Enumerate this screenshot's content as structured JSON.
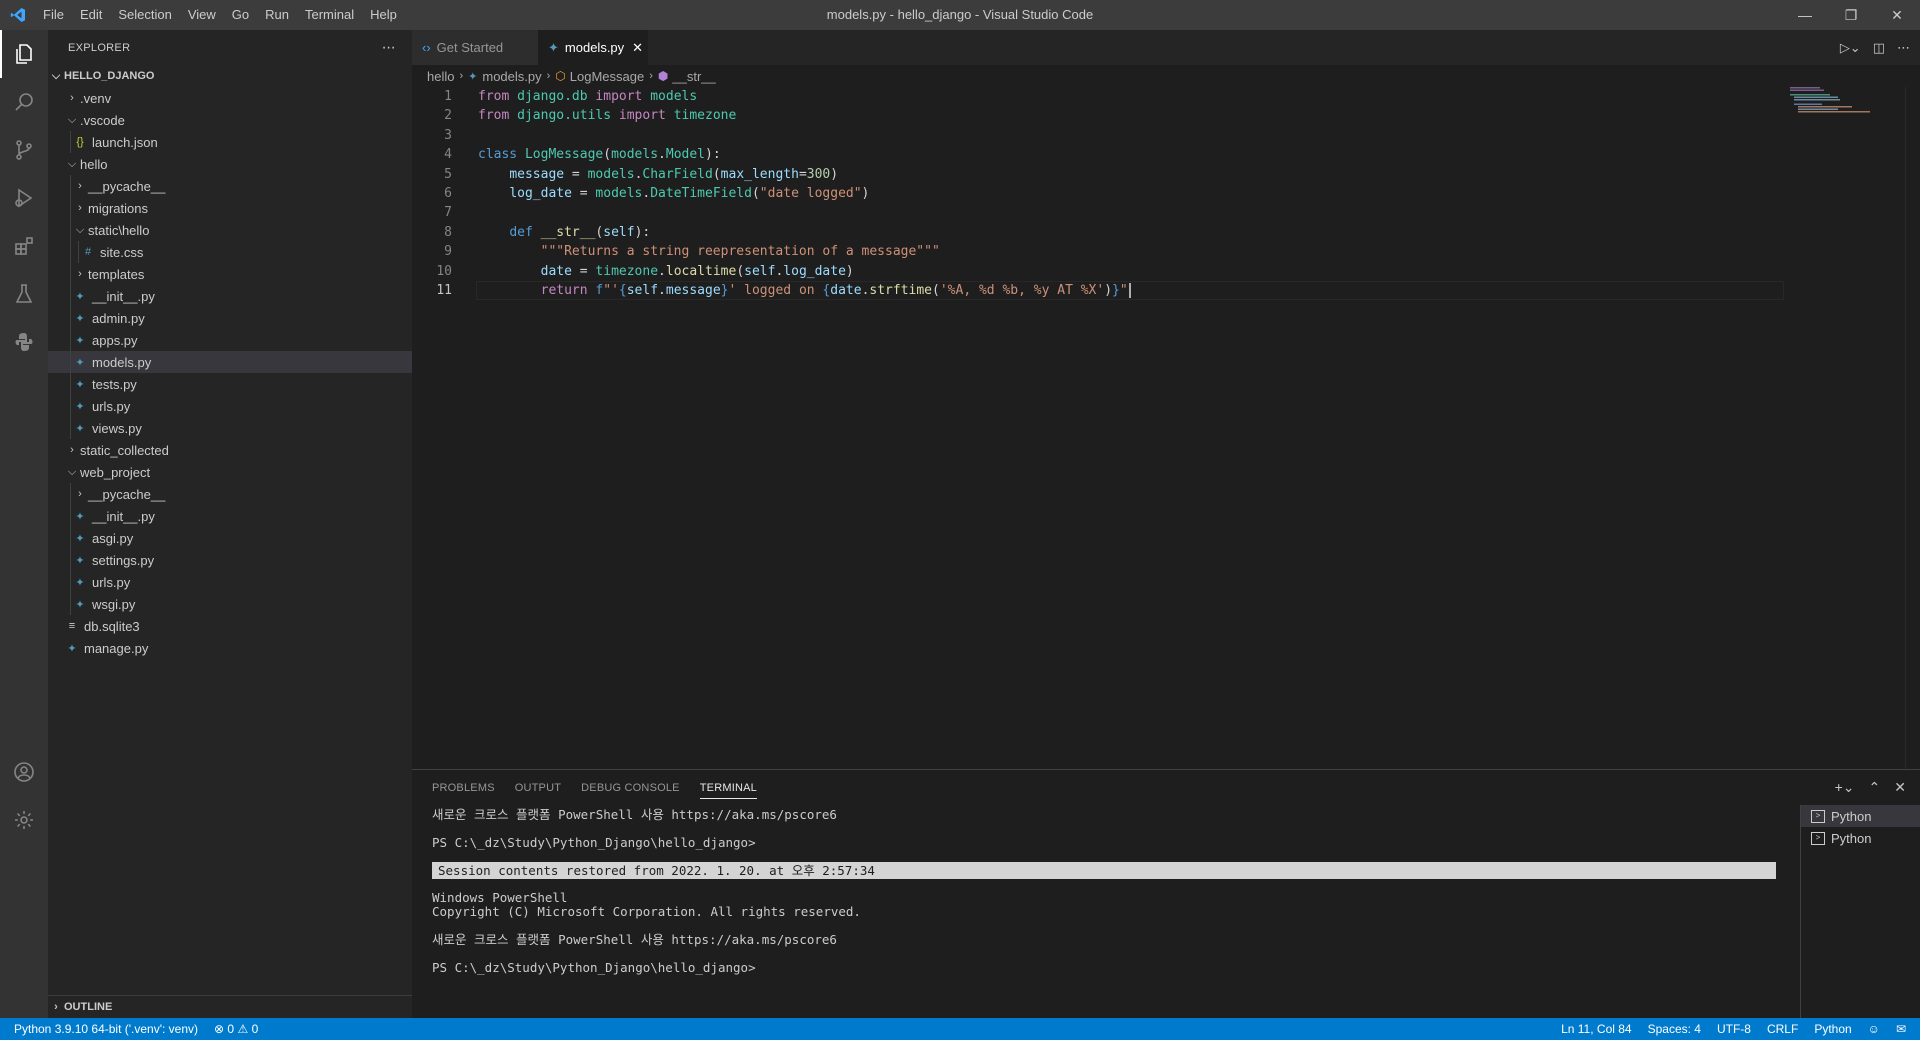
{
  "window": {
    "title": "models.py - hello_django - Visual Studio Code",
    "menu": [
      "File",
      "Edit",
      "Selection",
      "View",
      "Go",
      "Run",
      "Terminal",
      "Help"
    ]
  },
  "activity_bar": [
    "files-icon",
    "search-icon",
    "source-control-icon",
    "run-debug-icon",
    "extensions-icon",
    "testing-icon",
    "python-icon",
    "account-icon",
    "settings-gear-icon"
  ],
  "sidebar": {
    "title": "EXPLORER",
    "root": "HELLO_DJANGO",
    "tree": [
      {
        "label": ".venv",
        "type": "folder",
        "expanded": false,
        "depth": 1
      },
      {
        "label": ".vscode",
        "type": "folder",
        "expanded": true,
        "depth": 1
      },
      {
        "label": "launch.json",
        "type": "json",
        "depth": 2
      },
      {
        "label": "hello",
        "type": "folder",
        "expanded": true,
        "depth": 1
      },
      {
        "label": "__pycache__",
        "type": "folder",
        "expanded": false,
        "depth": 2
      },
      {
        "label": "migrations",
        "type": "folder",
        "expanded": false,
        "depth": 2
      },
      {
        "label": "static\\hello",
        "type": "folder",
        "expanded": true,
        "depth": 2
      },
      {
        "label": "site.css",
        "type": "css",
        "depth": 3
      },
      {
        "label": "templates",
        "type": "folder",
        "expanded": false,
        "depth": 2
      },
      {
        "label": "__init__.py",
        "type": "py",
        "depth": 2
      },
      {
        "label": "admin.py",
        "type": "py",
        "depth": 2
      },
      {
        "label": "apps.py",
        "type": "py",
        "depth": 2
      },
      {
        "label": "models.py",
        "type": "py",
        "depth": 2,
        "selected": true
      },
      {
        "label": "tests.py",
        "type": "py",
        "depth": 2
      },
      {
        "label": "urls.py",
        "type": "py",
        "depth": 2
      },
      {
        "label": "views.py",
        "type": "py",
        "depth": 2
      },
      {
        "label": "static_collected",
        "type": "folder",
        "expanded": false,
        "depth": 1
      },
      {
        "label": "web_project",
        "type": "folder",
        "expanded": true,
        "depth": 1
      },
      {
        "label": "__pycache__",
        "type": "folder",
        "expanded": false,
        "depth": 2
      },
      {
        "label": "__init__.py",
        "type": "py",
        "depth": 2
      },
      {
        "label": "asgi.py",
        "type": "py",
        "depth": 2
      },
      {
        "label": "settings.py",
        "type": "py",
        "depth": 2
      },
      {
        "label": "urls.py",
        "type": "py",
        "depth": 2
      },
      {
        "label": "wsgi.py",
        "type": "py",
        "depth": 2
      },
      {
        "label": "db.sqlite3",
        "type": "db",
        "depth": 1
      },
      {
        "label": "manage.py",
        "type": "py",
        "depth": 1
      }
    ],
    "outline_label": "OUTLINE"
  },
  "tabs": [
    {
      "label": "Get Started",
      "active": false
    },
    {
      "label": "models.py",
      "active": true
    }
  ],
  "breadcrumb": [
    "hello",
    "models.py",
    "LogMessage",
    "__str__"
  ],
  "editor": {
    "current_line": 11,
    "lines": [
      [
        [
          "kw",
          "from"
        ],
        [
          "t",
          " "
        ],
        [
          "mod",
          "django.db"
        ],
        [
          "t",
          " "
        ],
        [
          "kw",
          "import"
        ],
        [
          "t",
          " "
        ],
        [
          "mod",
          "models"
        ]
      ],
      [
        [
          "kw",
          "from"
        ],
        [
          "t",
          " "
        ],
        [
          "mod",
          "django.utils"
        ],
        [
          "t",
          " "
        ],
        [
          "kw",
          "import"
        ],
        [
          "t",
          " "
        ],
        [
          "mod",
          "timezone"
        ]
      ],
      [],
      [
        [
          "kwb",
          "class"
        ],
        [
          "t",
          " "
        ],
        [
          "mod",
          "LogMessage"
        ],
        [
          "t",
          "("
        ],
        [
          "mod",
          "models"
        ],
        [
          "t",
          "."
        ],
        [
          "mod",
          "Model"
        ],
        [
          "t",
          "):"
        ]
      ],
      [
        [
          "t",
          "    "
        ],
        [
          "var",
          "message"
        ],
        [
          "t",
          " = "
        ],
        [
          "mod",
          "models"
        ],
        [
          "t",
          "."
        ],
        [
          "mod",
          "CharField"
        ],
        [
          "t",
          "("
        ],
        [
          "var",
          "max_length"
        ],
        [
          "t",
          "="
        ],
        [
          "num",
          "300"
        ],
        [
          "t",
          ")"
        ]
      ],
      [
        [
          "t",
          "    "
        ],
        [
          "var",
          "log_date"
        ],
        [
          "t",
          " = "
        ],
        [
          "mod",
          "models"
        ],
        [
          "t",
          "."
        ],
        [
          "mod",
          "DateTimeField"
        ],
        [
          "t",
          "("
        ],
        [
          "str",
          "\"date logged\""
        ],
        [
          "t",
          ")"
        ]
      ],
      [],
      [
        [
          "t",
          "    "
        ],
        [
          "kwb",
          "def"
        ],
        [
          "t",
          " "
        ],
        [
          "fn",
          "__str__"
        ],
        [
          "t",
          "("
        ],
        [
          "var",
          "self"
        ],
        [
          "t",
          "):"
        ]
      ],
      [
        [
          "t",
          "        "
        ],
        [
          "str",
          "\"\"\"Returns a string reepresentation of a message\"\"\""
        ]
      ],
      [
        [
          "t",
          "        "
        ],
        [
          "var",
          "date"
        ],
        [
          "t",
          " = "
        ],
        [
          "mod",
          "timezone"
        ],
        [
          "t",
          "."
        ],
        [
          "fn",
          "localtime"
        ],
        [
          "t",
          "("
        ],
        [
          "var",
          "self"
        ],
        [
          "t",
          "."
        ],
        [
          "var",
          "log_date"
        ],
        [
          "t",
          ")"
        ]
      ],
      [
        [
          "t",
          "        "
        ],
        [
          "kw",
          "return"
        ],
        [
          "t",
          " "
        ],
        [
          "kwb",
          "f"
        ],
        [
          "str",
          "\"'"
        ],
        [
          "brace",
          "{"
        ],
        [
          "var",
          "self"
        ],
        [
          "t",
          "."
        ],
        [
          "var",
          "message"
        ],
        [
          "brace",
          "}"
        ],
        [
          "str",
          "' logged on "
        ],
        [
          "brace",
          "{"
        ],
        [
          "var",
          "date"
        ],
        [
          "t",
          "."
        ],
        [
          "fn",
          "strftime"
        ],
        [
          "t",
          "("
        ],
        [
          "str",
          "'%A, %d %b, %y AT %X'"
        ],
        [
          "t",
          ")"
        ],
        [
          "brace",
          "}"
        ],
        [
          "str",
          "\""
        ]
      ]
    ]
  },
  "panel": {
    "tabs": [
      "PROBLEMS",
      "OUTPUT",
      "DEBUG CONSOLE",
      "TERMINAL"
    ],
    "active_tab": "TERMINAL",
    "terminal_lines": [
      {
        "text": "새로운 크로스 플랫폼 PowerShell 사용 https://aka.ms/pscore6",
        "banner": false
      },
      {
        "text": "",
        "banner": false
      },
      {
        "text": "PS C:\\_dz\\Study\\Python_Django\\hello_django>",
        "banner": false
      },
      {
        "text": "",
        "banner": false
      },
      {
        "text": "Session contents restored from 2022. 1. 20. at 오후 2:57:34",
        "banner": true
      },
      {
        "text": "",
        "banner": false
      },
      {
        "text": "Windows PowerShell",
        "banner": false
      },
      {
        "text": "Copyright (C) Microsoft Corporation. All rights reserved.",
        "banner": false
      },
      {
        "text": "",
        "banner": false
      },
      {
        "text": "새로운 크로스 플랫폼 PowerShell 사용 https://aka.ms/pscore6",
        "banner": false
      },
      {
        "text": "",
        "banner": false
      },
      {
        "text": "PS C:\\_dz\\Study\\Python_Django\\hello_django>",
        "banner": false
      }
    ],
    "terminals": [
      "Python",
      "Python"
    ]
  },
  "statusbar": {
    "interpreter": "Python 3.9.10 64-bit ('.venv': venv)",
    "errors": "0",
    "warnings": "0",
    "position": "Ln 11, Col 84",
    "spaces": "Spaces: 4",
    "encoding": "UTF-8",
    "eol": "CRLF",
    "language": "Python"
  },
  "colors": {
    "accent": "#007acc",
    "python_file": "#519aba",
    "json_file": "#cbcb41"
  }
}
